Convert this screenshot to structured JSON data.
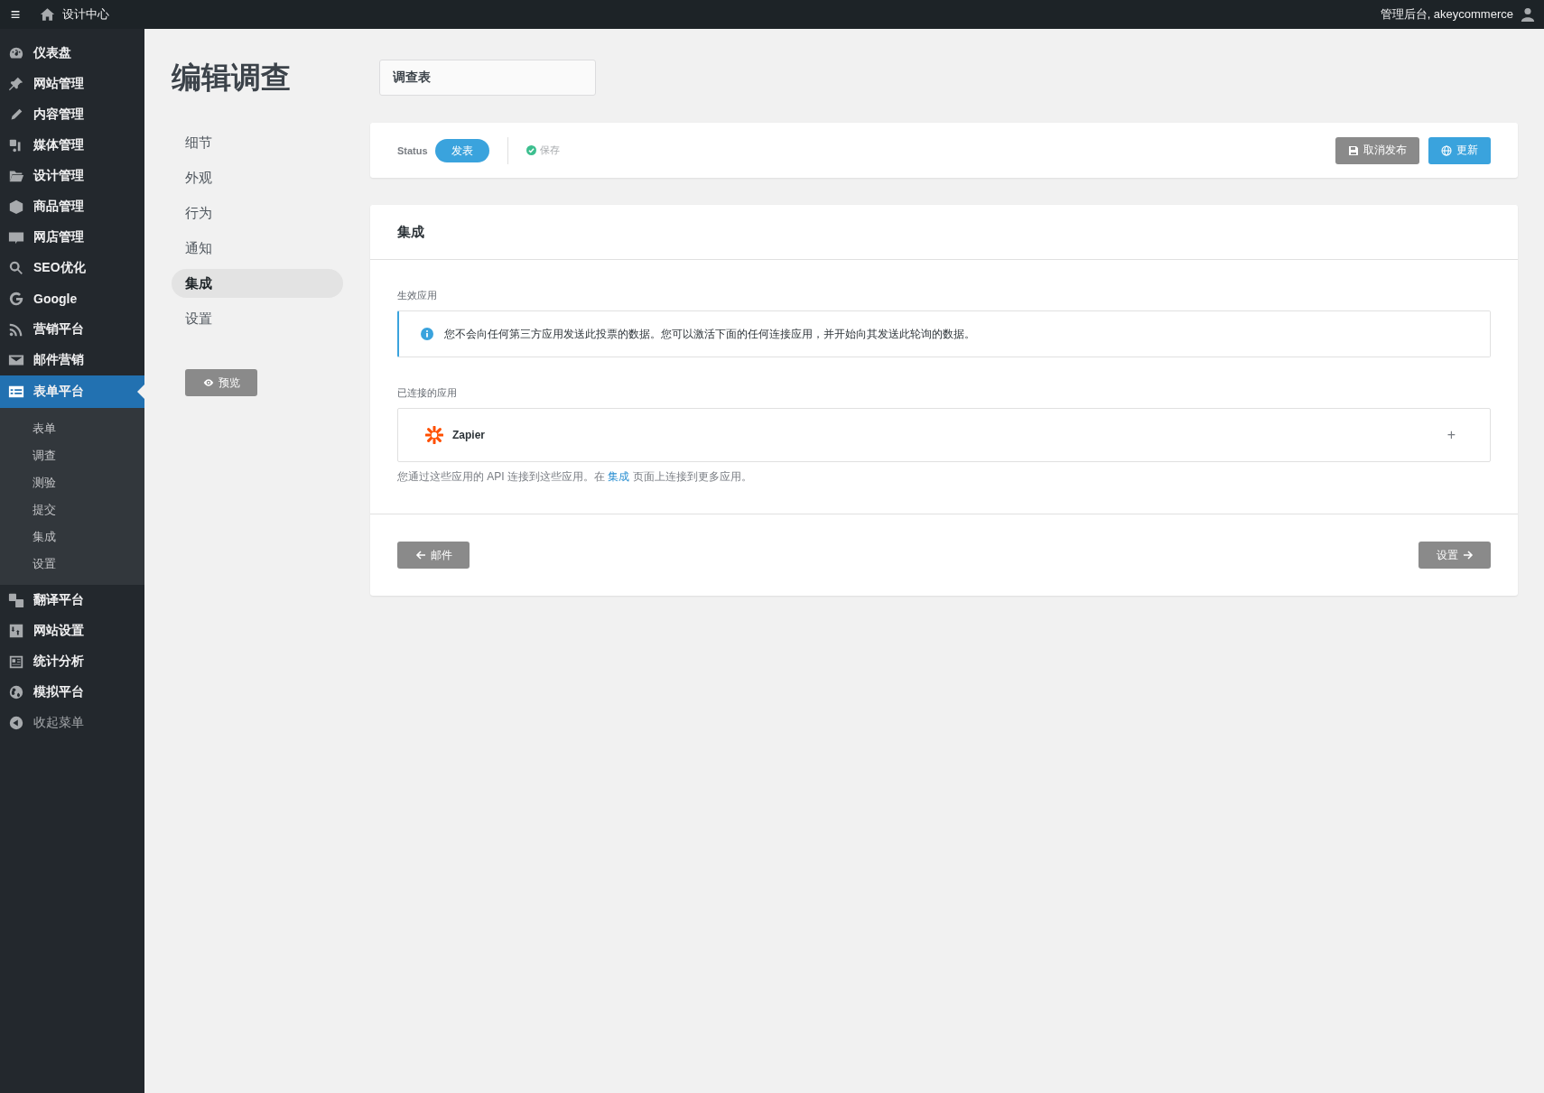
{
  "topbar": {
    "menu_glyph": "≡",
    "site_name": "设计中心",
    "account": "管理后台, akeycommerce"
  },
  "sidebar": {
    "items": [
      {
        "label": "仪表盘",
        "selected": false
      },
      {
        "label": "网站管理",
        "selected": false
      },
      {
        "label": "内容管理",
        "selected": false
      },
      {
        "label": "媒体管理",
        "selected": false
      },
      {
        "label": "设计管理",
        "selected": false
      },
      {
        "label": "商品管理",
        "selected": false
      },
      {
        "label": "网店管理",
        "selected": false
      },
      {
        "label": "SEO优化",
        "selected": false
      },
      {
        "label": "Google",
        "selected": false
      },
      {
        "label": "营销平台",
        "selected": false
      },
      {
        "label": "邮件营销",
        "selected": false
      },
      {
        "label": "表单平台",
        "selected": true,
        "children": [
          {
            "label": "表单",
            "selected": false
          },
          {
            "label": "调查",
            "selected": false
          },
          {
            "label": "测验",
            "selected": false
          },
          {
            "label": "提交",
            "selected": false
          },
          {
            "label": "集成",
            "selected": false
          },
          {
            "label": "设置",
            "selected": false
          }
        ]
      },
      {
        "label": "翻译平台",
        "selected": false
      },
      {
        "label": "网站设置",
        "selected": false
      },
      {
        "label": "统计分析",
        "selected": false
      },
      {
        "label": "模拟平台",
        "selected": false
      }
    ],
    "collapse": "收起菜单"
  },
  "page_title": "编辑调查",
  "title_field": {
    "value": "调查表"
  },
  "subnav": {
    "items": [
      {
        "label": "细节",
        "selected": false
      },
      {
        "label": "外观",
        "selected": false
      },
      {
        "label": "行为",
        "selected": false
      },
      {
        "label": "通知",
        "selected": false
      },
      {
        "label": "集成",
        "selected": true
      },
      {
        "label": "设置",
        "selected": false
      }
    ],
    "preview_button": "预览"
  },
  "status_bar": {
    "label": "Status",
    "status": "发表",
    "save_state": "保存",
    "buttons": [
      {
        "label": "取消发布",
        "kind": "secondary"
      },
      {
        "label": "更新",
        "kind": "primary"
      }
    ]
  },
  "integration": {
    "title": "集成",
    "active_label": "生效应用",
    "notice": "您不会向任何第三方应用发送此投票的数据。您可以激活下面的任何连接应用，并开始向其发送此轮询的数据。",
    "connected_label": "已连接的应用",
    "apps": [
      {
        "name": "Zapier",
        "action": "+"
      }
    ],
    "help_before": "您通过这些应用的 API 连接到这些应用。在 ",
    "help_link": "集成",
    "help_after": " 页面上连接到更多应用。",
    "back_button": "邮件",
    "next_button": "设置"
  }
}
